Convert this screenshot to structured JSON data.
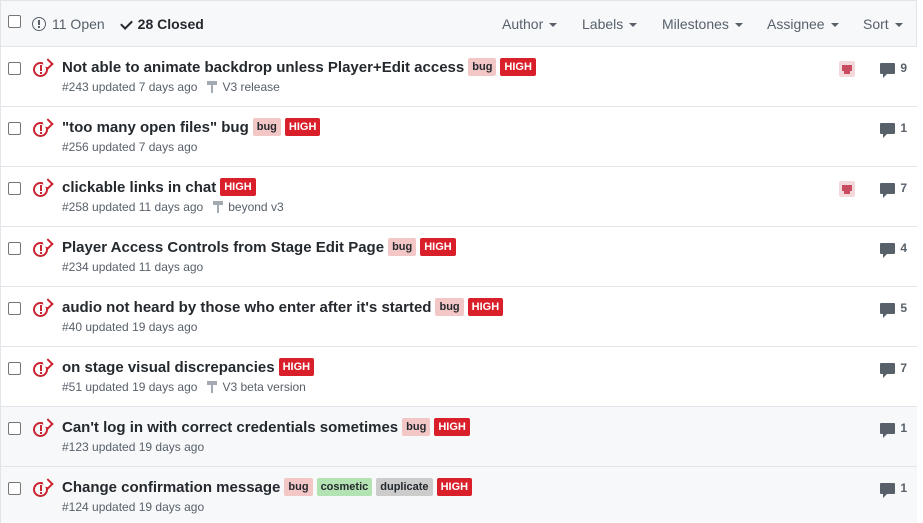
{
  "header": {
    "open_label": "11 Open",
    "closed_label": "28 Closed",
    "filters": {
      "author": "Author",
      "labels": "Labels",
      "milestones": "Milestones",
      "assignee": "Assignee",
      "sort": "Sort"
    }
  },
  "issues": [
    {
      "title": "Not able to animate backdrop unless Player+Edit access",
      "labels": [
        "bug",
        "HIGH"
      ],
      "meta": "#243 updated 7 days ago",
      "milestone": "V3 release",
      "assignee": true,
      "comments": "9"
    },
    {
      "title": "\"too many open files\" bug",
      "labels": [
        "bug",
        "HIGH"
      ],
      "meta": "#256 updated 7 days ago",
      "milestone": "",
      "assignee": false,
      "comments": "1"
    },
    {
      "title": "clickable links in chat",
      "labels": [
        "HIGH"
      ],
      "meta": "#258 updated 11 days ago",
      "milestone": "beyond v3",
      "assignee": true,
      "comments": "7"
    },
    {
      "title": "Player Access Controls from Stage Edit Page",
      "labels": [
        "bug",
        "HIGH"
      ],
      "meta": "#234 updated 11 days ago",
      "milestone": "",
      "assignee": false,
      "comments": "4"
    },
    {
      "title": "audio not heard by those who enter after it's started",
      "labels": [
        "bug",
        "HIGH"
      ],
      "meta": "#40 updated 19 days ago",
      "milestone": "",
      "assignee": false,
      "comments": "5"
    },
    {
      "title": "on stage visual discrepancies",
      "labels": [
        "HIGH"
      ],
      "meta": "#51 updated 19 days ago",
      "milestone": "V3 beta version",
      "assignee": false,
      "comments": "7"
    },
    {
      "title": "Can't log in with correct credentials sometimes",
      "labels": [
        "bug",
        "HIGH"
      ],
      "meta": "#123 updated 19 days ago",
      "milestone": "",
      "assignee": false,
      "comments": "1"
    },
    {
      "title": "Change confirmation message",
      "labels": [
        "bug",
        "cosmetic",
        "duplicate",
        "HIGH"
      ],
      "meta": "#124 updated 19 days ago",
      "milestone": "",
      "assignee": false,
      "comments": "1"
    }
  ],
  "colors": {
    "open_icon": "#cb2431",
    "label_bug": "#f4c7c7",
    "label_high": "#d9202a",
    "label_cosmetic": "#b4e3b3",
    "label_duplicate": "#cccccc"
  }
}
